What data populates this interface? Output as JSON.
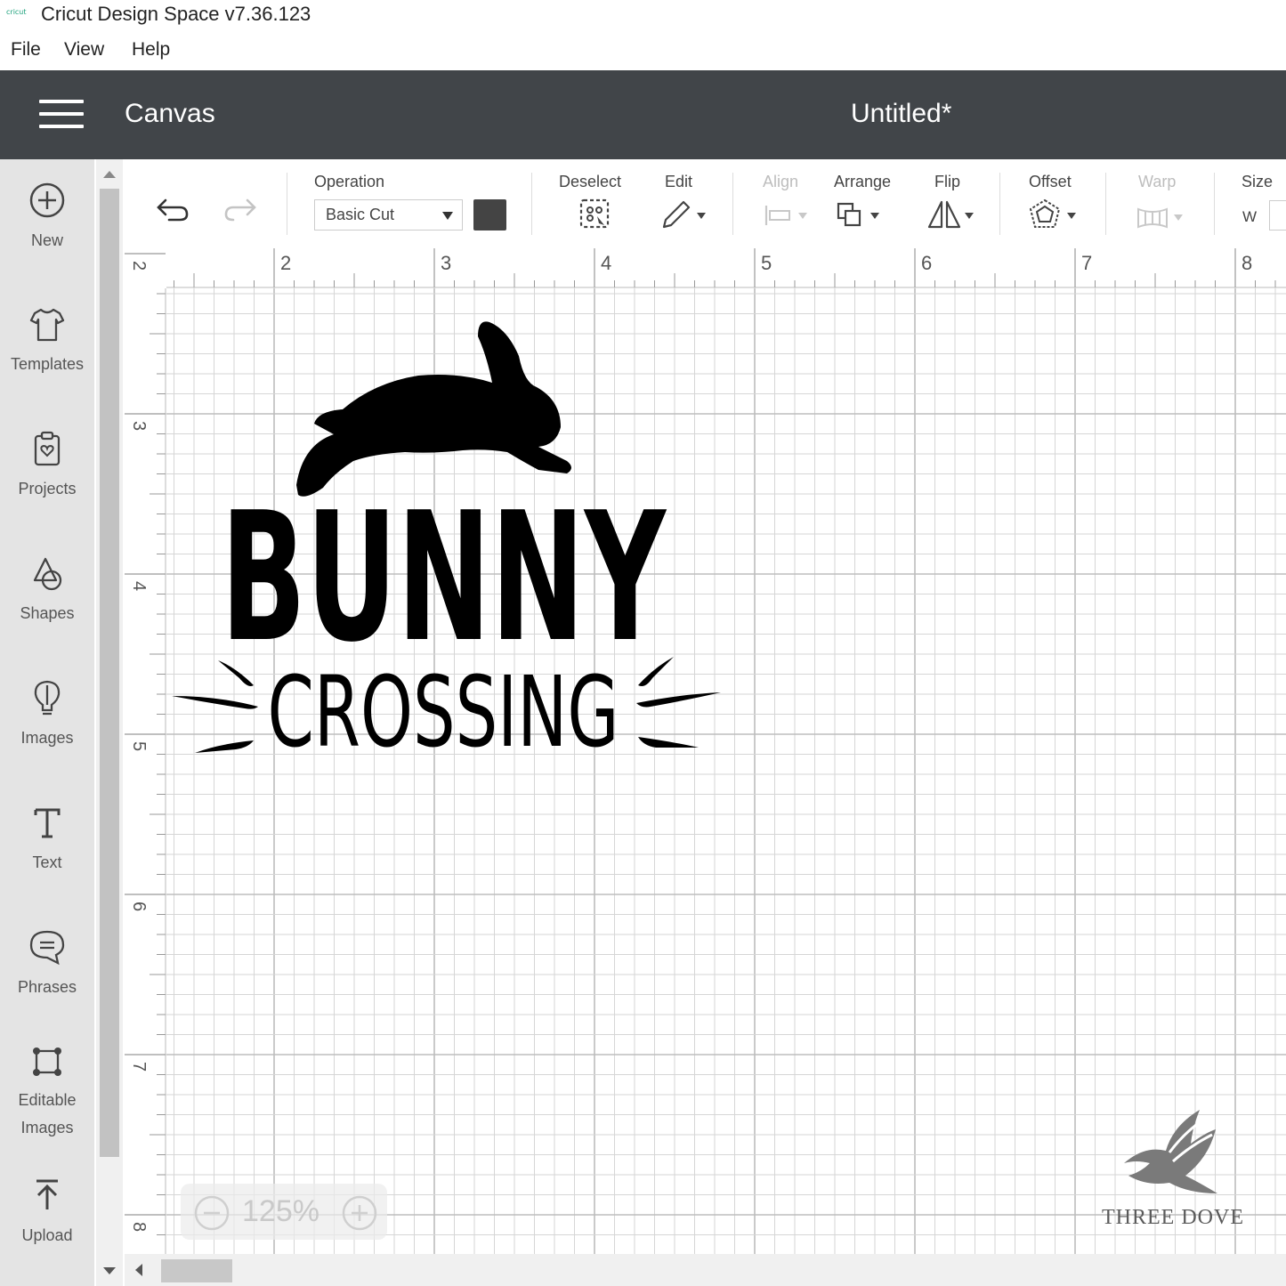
{
  "window": {
    "logo_text": "cricut",
    "title": "Cricut Design Space  v7.36.123"
  },
  "menu": [
    "File",
    "View",
    "Help"
  ],
  "header": {
    "section": "Canvas",
    "document": "Untitled*"
  },
  "sidebar": [
    {
      "label": "New",
      "icon": "plus-circle-icon"
    },
    {
      "label": "Templates",
      "icon": "tshirt-icon"
    },
    {
      "label": "Projects",
      "icon": "clipboard-heart-icon"
    },
    {
      "label": "Shapes",
      "icon": "shapes-icon"
    },
    {
      "label": "Images",
      "icon": "lightbulb-icon"
    },
    {
      "label": "Text",
      "icon": "text-t-icon"
    },
    {
      "label": "Phrases",
      "icon": "speech-bubble-icon"
    },
    {
      "label": "Editable\nImages",
      "icon": "editable-image-icon"
    },
    {
      "label": "Upload",
      "icon": "upload-icon"
    }
  ],
  "toolbar": {
    "operation_label": "Operation",
    "operation_value": "Basic Cut",
    "color": "#444444",
    "deselect": "Deselect",
    "edit": "Edit",
    "align": "Align",
    "arrange": "Arrange",
    "flip": "Flip",
    "offset": "Offset",
    "warp": "Warp",
    "size": "Size",
    "size_w": "W"
  },
  "rulers": {
    "top": [
      "2",
      "3",
      "4",
      "5",
      "6",
      "7",
      "8"
    ],
    "left": [
      "2",
      "3",
      "4",
      "5",
      "6",
      "7",
      "8"
    ]
  },
  "design": {
    "line1": "BUNNY",
    "line2": "CROSSING"
  },
  "zoom": "125%",
  "watermark": "THREE DOVE",
  "colors": {
    "header_bg": "#414549",
    "sidebar_bg": "#e4e4e4",
    "grid_line": "#d6d6d6",
    "grid_major": "#bdbdbd"
  }
}
